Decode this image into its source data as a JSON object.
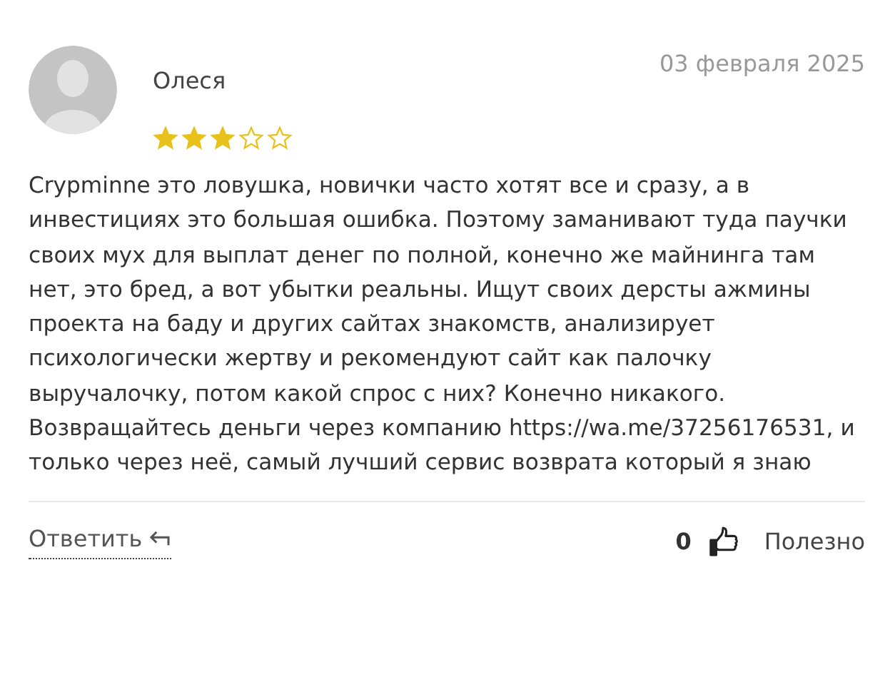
{
  "review": {
    "author": "Олеся",
    "date": "03 февраля 2025",
    "stars": 3,
    "text_before": "Crypminne это ловушка, новички часто хотят все и сразу, а в инвестициях это большая ошибка. Поэтому заманивают туда паучки своих мух для выплат денег по полной, конечно же майнинга там нет, это бред, а вот убытки реальны. Ищут своих дерсты ажмины проекта на баду и других сайтах знакомств, анализирует психологически жертву и рекомендуют сайт как палочку выручалочку, потом какой спрос с них? Конечно никакого. Возвращайтесь деньги через компанию",
    "link": "https://wa.me/37256176531",
    "text_after": ", и только через неё, самый лучший сервис возврата который я знаю"
  },
  "footer": {
    "reply": "Ответить",
    "likes": "0",
    "helpful": "Полезно"
  }
}
